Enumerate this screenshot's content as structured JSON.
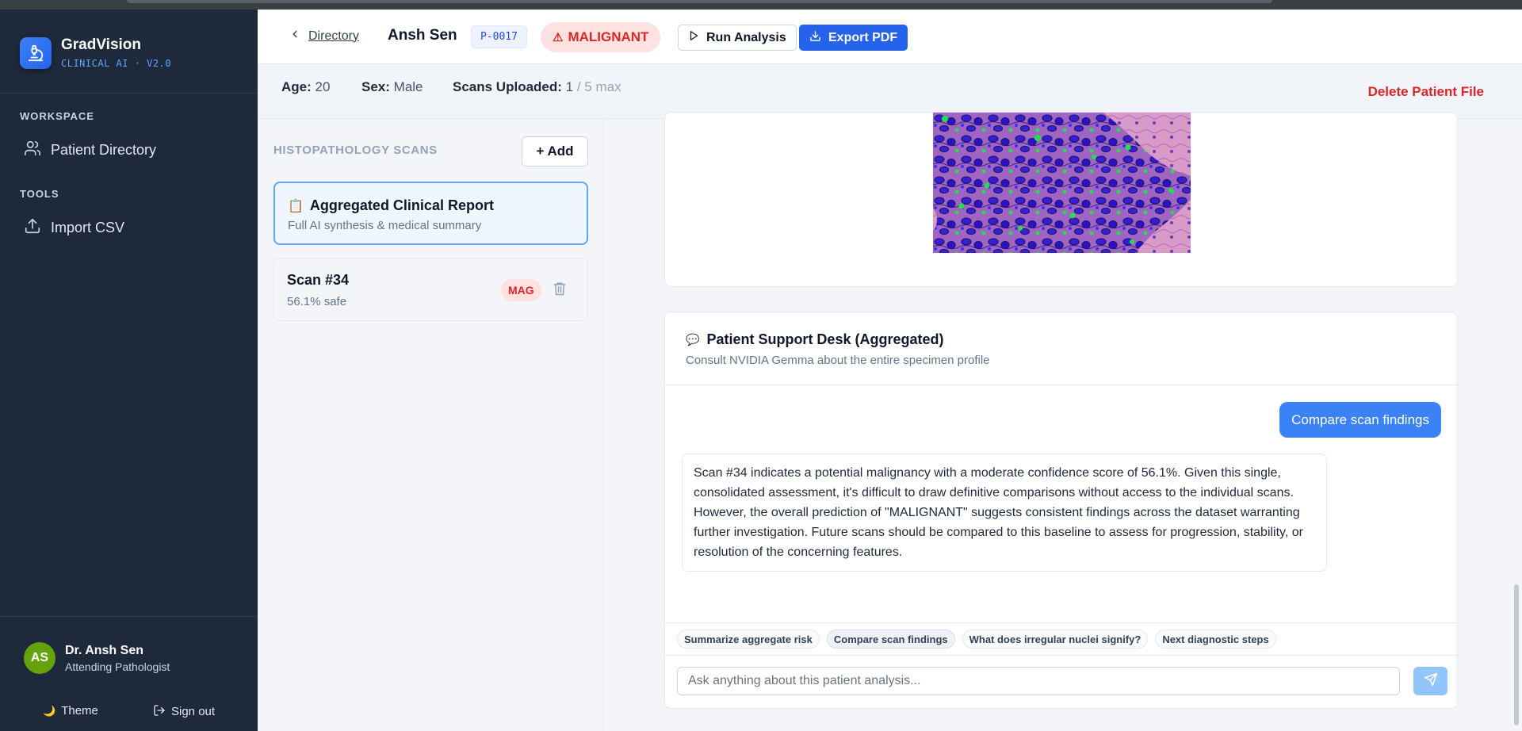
{
  "app": {
    "name": "GradVision",
    "subtitle": "CLINICAL AI · V2.0"
  },
  "sidebar": {
    "sections": [
      {
        "title": "WORKSPACE",
        "items": [
          {
            "label": "Patient Directory",
            "icon": "users-icon"
          }
        ]
      },
      {
        "title": "TOOLS",
        "items": [
          {
            "label": "Import CSV",
            "icon": "upload-icon"
          }
        ]
      }
    ],
    "user": {
      "initials": "AS",
      "name": "Dr. Ansh Sen",
      "role": "Attending Pathologist"
    },
    "actions": {
      "theme": "Theme",
      "signout": "Sign out"
    }
  },
  "header": {
    "back_label": "Directory",
    "patient_name": "Ansh Sen",
    "patient_id": "P-0017",
    "status": "MALIGNANT",
    "run_label": "Run Analysis",
    "export_label": "Export PDF"
  },
  "info": {
    "age_label": "Age:",
    "age": "20",
    "sex_label": "Sex:",
    "sex": "Male",
    "scans_label": "Scans Uploaded:",
    "scans_count": "1",
    "scans_max": "/ 5 max",
    "delete_label": "Delete Patient File"
  },
  "scans": {
    "heading": "HISTOPATHOLOGY SCANS",
    "add_label": "+ Add",
    "report": {
      "title": "Aggregated Clinical Report",
      "subtitle": "Full AI synthesis & medical summary"
    },
    "items": [
      {
        "title": "Scan #34",
        "subtitle": "56.1% safe",
        "badge": "MAG"
      }
    ]
  },
  "chat": {
    "title": "Patient Support Desk (Aggregated)",
    "subtitle": "Consult NVIDIA Gemma about the entire specimen profile",
    "user_message": "Compare scan findings",
    "ai_message": "Scan #34 indicates a potential malignancy with a moderate confidence score of 56.1%. Given this single, consolidated assessment, it's difficult to draw definitive comparisons without access to the individual scans. However, the overall prediction of \"MALIGNANT\" suggests consistent findings across the dataset warranting further investigation. Future scans should be compared to this baseline to assess for progression, stability, or resolution of the concerning features.",
    "chips": [
      "Summarize aggregate risk",
      "Compare scan findings",
      "What does irregular nuclei signify?",
      "Next diagnostic steps"
    ],
    "active_chip": "Compare scan findings",
    "input_placeholder": "Ask anything about this patient analysis..."
  },
  "colors": {
    "primary": "#2563eb",
    "danger": "#dc2626",
    "sidebar": "#1e293b",
    "accent": "#60a5fa"
  }
}
